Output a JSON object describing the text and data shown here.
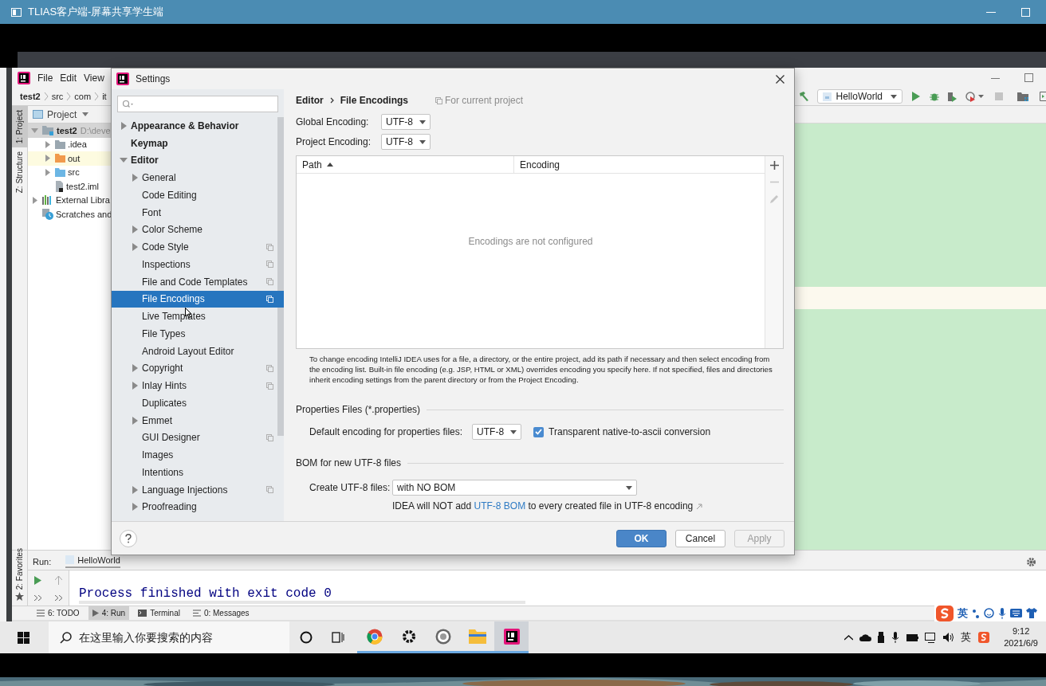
{
  "viewer": {
    "title": "TLIAS客户端-屏幕共享学生端"
  },
  "ide": {
    "menu": [
      "File",
      "Edit",
      "View"
    ],
    "breadcrumb": [
      "test2",
      "src",
      "com",
      "it"
    ],
    "run_config": "HelloWorld",
    "side_tabs": [
      {
        "label": "1: Project",
        "selected": true
      },
      {
        "label": "Z: Structure",
        "selected": false
      }
    ],
    "favorites_tab": "2: Favorites",
    "project_panel": {
      "title": "Project",
      "tree": [
        {
          "label": "test2",
          "path": "D:\\deve",
          "kind": "module",
          "expanded": true,
          "selected": true,
          "children": [
            {
              "label": ".idea",
              "kind": "folder",
              "expanded": false,
              "selected": false
            },
            {
              "label": "out",
              "kind": "excluded-folder",
              "expanded": false,
              "selected": false
            },
            {
              "label": "src",
              "kind": "source-folder",
              "expanded": false,
              "selected": false
            },
            {
              "label": "test2.iml",
              "kind": "file",
              "selected": false
            }
          ]
        },
        {
          "label": "External Libra",
          "kind": "library",
          "expanded": false,
          "selected": false
        },
        {
          "label": "Scratches and",
          "kind": "scratches",
          "selected": false
        }
      ]
    },
    "run_panel": {
      "label": "Run:",
      "tab": "HelloWorld",
      "output": "Process finished with exit code 0"
    },
    "tool_tabs": [
      {
        "label": "6: TODO",
        "kind": "todo",
        "selected": false
      },
      {
        "label": "4: Run",
        "kind": "run",
        "selected": true
      },
      {
        "label": "Terminal",
        "kind": "terminal",
        "selected": false
      },
      {
        "label": "0: Messages",
        "kind": "messages",
        "selected": false
      }
    ]
  },
  "settings": {
    "title": "Settings",
    "tree": [
      {
        "label": "Appearance & Behavior",
        "expanded": false,
        "selected": false,
        "project_scope": false
      },
      {
        "label": "Keymap",
        "selected": false,
        "project_scope": false
      },
      {
        "label": "Editor",
        "expanded": true,
        "selected": false,
        "project_scope": false,
        "children": [
          {
            "label": "General",
            "expanded": false,
            "selected": false,
            "project_scope": false
          },
          {
            "label": "Code Editing",
            "selected": false,
            "project_scope": false
          },
          {
            "label": "Font",
            "selected": false,
            "project_scope": false
          },
          {
            "label": "Color Scheme",
            "expanded": false,
            "selected": false,
            "project_scope": false
          },
          {
            "label": "Code Style",
            "expanded": false,
            "selected": false,
            "project_scope": true
          },
          {
            "label": "Inspections",
            "selected": false,
            "project_scope": true
          },
          {
            "label": "File and Code Templates",
            "selected": false,
            "project_scope": true
          },
          {
            "label": "File Encodings",
            "selected": true,
            "project_scope": true
          },
          {
            "label": "Live Templates",
            "selected": false,
            "project_scope": false
          },
          {
            "label": "File Types",
            "selected": false,
            "project_scope": false
          },
          {
            "label": "Android Layout Editor",
            "selected": false,
            "project_scope": false
          },
          {
            "label": "Copyright",
            "expanded": false,
            "selected": false,
            "project_scope": true
          },
          {
            "label": "Inlay Hints",
            "expanded": false,
            "selected": false,
            "project_scope": true
          },
          {
            "label": "Duplicates",
            "selected": false,
            "project_scope": false
          },
          {
            "label": "Emmet",
            "expanded": false,
            "selected": false,
            "project_scope": false
          },
          {
            "label": "GUI Designer",
            "selected": false,
            "project_scope": true
          },
          {
            "label": "Images",
            "selected": false,
            "project_scope": false
          },
          {
            "label": "Intentions",
            "selected": false,
            "project_scope": false
          },
          {
            "label": "Language Injections",
            "expanded": false,
            "selected": false,
            "project_scope": true
          },
          {
            "label": "Proofreading",
            "expanded": false,
            "selected": false,
            "project_scope": false
          }
        ]
      }
    ],
    "breadcrumb": [
      "Editor",
      "File Encodings"
    ],
    "scope_note": "For current project",
    "global_encoding": {
      "label": "Global Encoding:",
      "value": "UTF-8"
    },
    "project_encoding": {
      "label": "Project Encoding:",
      "value": "UTF-8"
    },
    "table": {
      "columns": [
        {
          "label": "Path",
          "sorted": true
        },
        {
          "label": "Encoding",
          "sorted": false
        }
      ],
      "empty_text": "Encodings are not configured",
      "actions": [
        {
          "kind": "add",
          "disabled": false
        },
        {
          "kind": "remove",
          "disabled": true
        },
        {
          "kind": "edit",
          "disabled": true
        }
      ]
    },
    "help_text": "To change encoding IntelliJ IDEA uses for a file, a directory, or the entire project, add its path if necessary and then select encoding from the encoding list. Built-in file encoding (e.g. JSP, HTML or XML) overrides encoding you specify here. If not specified, files and directories inherit encoding settings from the parent directory or from the Project Encoding.",
    "properties": {
      "heading": "Properties Files (*.properties)",
      "label": "Default encoding for properties files:",
      "value": "UTF-8",
      "checkbox": {
        "label": "Transparent native-to-ascii conversion",
        "checked": true
      }
    },
    "bom": {
      "heading": "BOM for new UTF-8 files",
      "label": "Create UTF-8 files:",
      "value": "with NO BOM",
      "note": {
        "before": "IDEA will NOT add",
        "link": "UTF-8 BOM",
        "after": "to every created file in UTF-8 encoding"
      }
    },
    "buttons": [
      {
        "label": "OK",
        "kind": "default",
        "disabled": false
      },
      {
        "label": "Cancel",
        "kind": "normal",
        "disabled": false
      },
      {
        "label": "Apply",
        "kind": "normal",
        "disabled": true
      }
    ]
  },
  "sogou_bar": {
    "mode": "英"
  },
  "taskbar": {
    "search_placeholder": "在这里输入你要搜索的内容",
    "apps": [
      {
        "kind": "chrome",
        "running": true,
        "selected": false
      },
      {
        "kind": "gear",
        "running": true,
        "selected": false
      },
      {
        "kind": "disc",
        "running": true,
        "selected": false
      },
      {
        "kind": "folder",
        "running": true,
        "selected": false
      },
      {
        "kind": "ide",
        "running": true,
        "selected": true
      }
    ],
    "ime": "英",
    "time": "9:12",
    "date": "2021/6/9"
  }
}
